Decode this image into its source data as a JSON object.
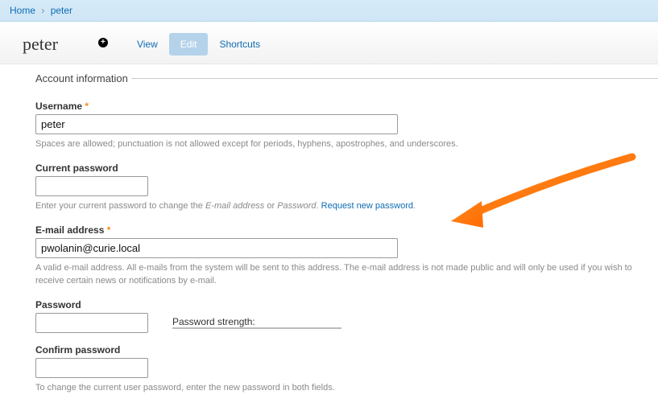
{
  "breadcrumb": {
    "home": "Home",
    "current": "peter"
  },
  "header": {
    "title": "peter",
    "plus_icon": "+",
    "tabs": {
      "view": "View",
      "edit": "Edit",
      "shortcuts": "Shortcuts"
    }
  },
  "fieldset": {
    "legend": "Account information"
  },
  "username": {
    "label": "Username",
    "value": "peter",
    "desc": "Spaces are allowed; punctuation is not allowed except for periods, hyphens, apostrophes, and underscores."
  },
  "current_password": {
    "label": "Current password",
    "value": "",
    "desc_prefix": "Enter your current password to change the ",
    "desc_em1": "E-mail address",
    "desc_or": " or ",
    "desc_em2": "Password",
    "desc_period": ". ",
    "request_link": "Request new password",
    "desc_end": "."
  },
  "email": {
    "label": "E-mail address",
    "value": "pwolanin@curie.local",
    "desc": "A valid e-mail address. All e-mails from the system will be sent to this address. The e-mail address is not made public and will only be used if you wish to receive certain news or notifications by e-mail."
  },
  "password": {
    "label": "Password",
    "value": "",
    "strength_label": "Password strength:"
  },
  "confirm_password": {
    "label": "Confirm password",
    "value": "",
    "desc": "To change the current user password, enter the new password in both fields."
  },
  "required_mark": "*"
}
